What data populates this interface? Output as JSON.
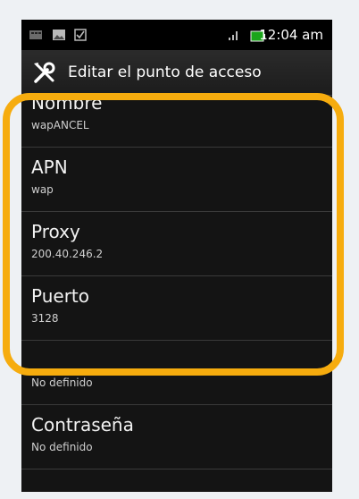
{
  "status_bar": {
    "time": "12:04 am"
  },
  "title_bar": {
    "title": "Editar el punto de acceso"
  },
  "settings": [
    {
      "title": "Nombre",
      "value": "wapANCEL"
    },
    {
      "title": "APN",
      "value": "wap"
    },
    {
      "title": "Proxy",
      "value": "200.40.246.2"
    },
    {
      "title": "Puerto",
      "value": "3128"
    },
    {
      "title": "",
      "value": "No definido"
    },
    {
      "title": "Contraseña",
      "value": "No definido"
    }
  ],
  "colors": {
    "highlight": "#f6ac0e",
    "background": "#141414",
    "status_bar": "#000000"
  }
}
